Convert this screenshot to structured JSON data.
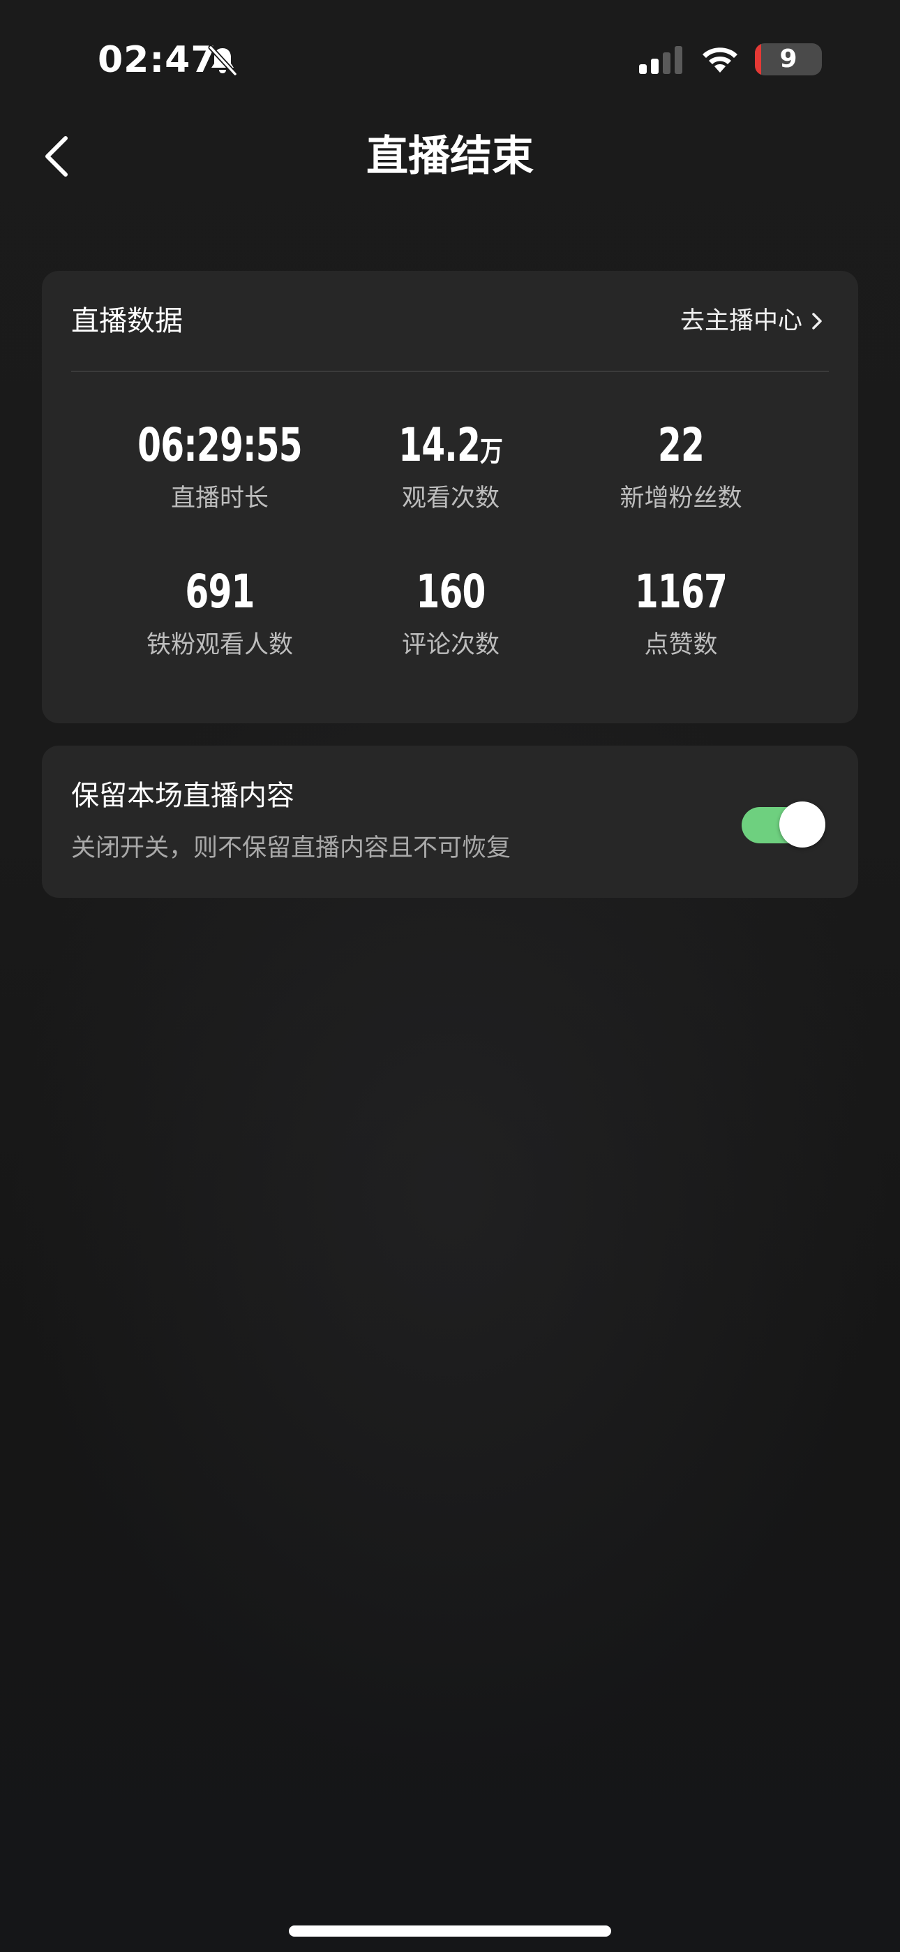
{
  "status_bar": {
    "time": "02:47",
    "battery_level": "9",
    "battery_percent": 9,
    "icons": [
      "bell-slash-icon",
      "cellular-signal-icon",
      "wifi-icon",
      "battery-icon"
    ]
  },
  "nav": {
    "back_icon": "chevron-left-icon",
    "title": "直播结束"
  },
  "stats_card": {
    "title": "直播数据",
    "link_label": "去主播中心",
    "link_icon": "chevron-right-icon",
    "stats": [
      {
        "value": "06:29:55",
        "unit": "",
        "label": "直播时长"
      },
      {
        "value": "14.2",
        "unit": "万",
        "label": "观看次数"
      },
      {
        "value": "22",
        "unit": "",
        "label": "新增粉丝数"
      },
      {
        "value": "691",
        "unit": "",
        "label": "铁粉观看人数"
      },
      {
        "value": "160",
        "unit": "",
        "label": "评论次数"
      },
      {
        "value": "1167",
        "unit": "",
        "label": "点赞数"
      }
    ]
  },
  "keep_card": {
    "title": "保留本场直播内容",
    "description": "关闭开关，则不保留直播内容且不可恢复",
    "toggle_on": true
  },
  "colors": {
    "background": "#171717",
    "card": "#272727",
    "toggle_on": "#6ed07f",
    "battery_low": "#e53935",
    "secondary_text": "#bdbdbd"
  }
}
